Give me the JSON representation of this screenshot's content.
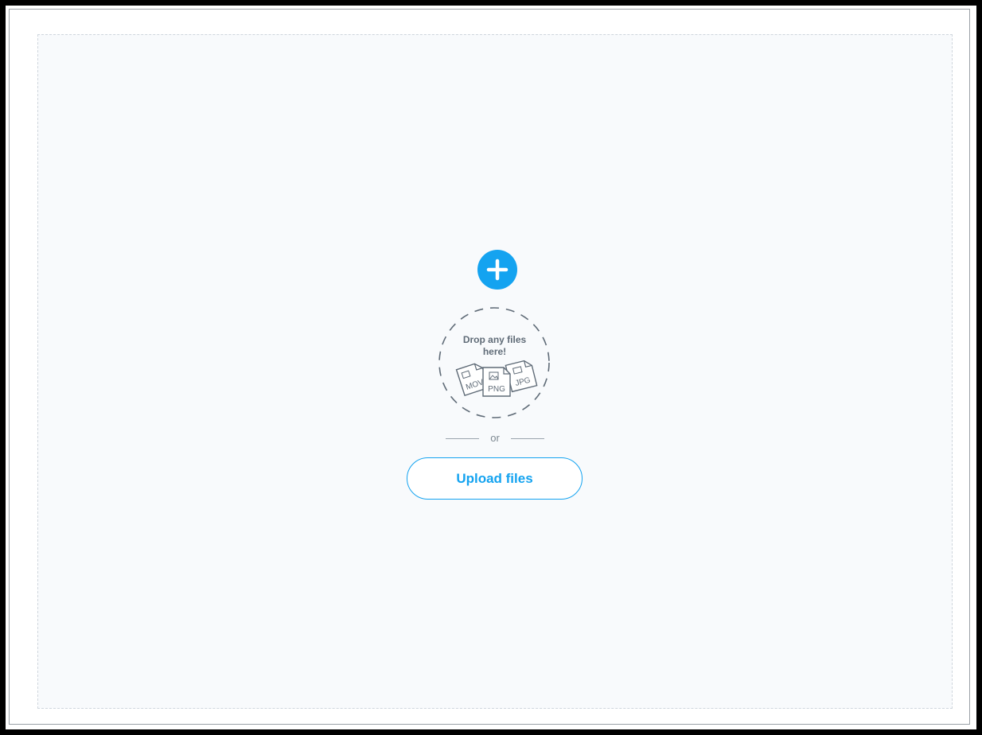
{
  "uploader": {
    "drop_text_line1": "Drop any files",
    "drop_text_line2": "here!",
    "divider_text": "or",
    "upload_button_label": "Upload files",
    "file_badges": [
      "MOV",
      "PNG",
      "JPG"
    ]
  },
  "colors": {
    "accent": "#14a3f0",
    "dropzone_bg": "#f8fafc",
    "muted_text": "#5f6b77"
  },
  "icons": {
    "add": "plus-circle-icon",
    "drop_area": "dashed-circle-icon",
    "files": "file-icon"
  }
}
